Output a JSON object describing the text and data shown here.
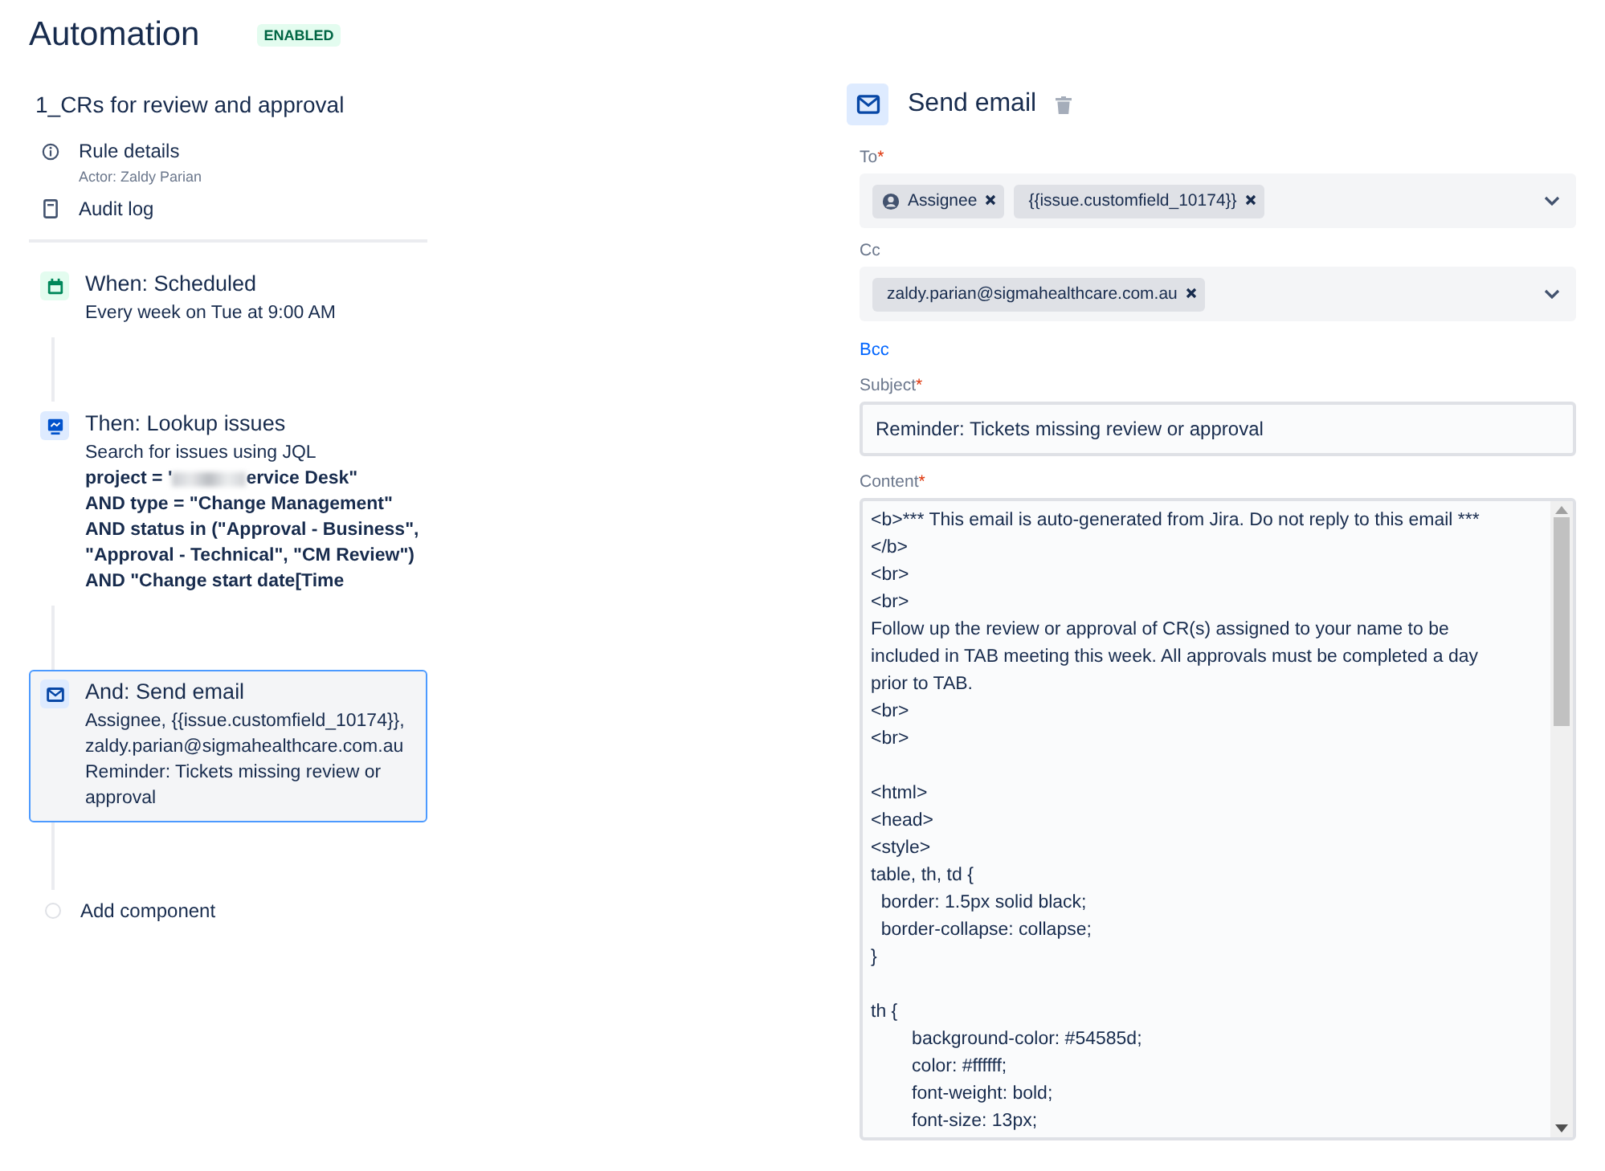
{
  "header": {
    "title": "Automation",
    "status": "ENABLED"
  },
  "rule": {
    "name": "1_CRs for review and approval",
    "links": [
      {
        "kind": "info",
        "label": "Rule details",
        "sub": "Actor: Zaldy Parian"
      },
      {
        "kind": "log",
        "label": "Audit log"
      }
    ]
  },
  "components": [
    {
      "kind": "trigger",
      "title": "When: Scheduled",
      "selected": false,
      "lines": [
        "Every week on Tue at 9:00 AM"
      ]
    },
    {
      "kind": "lookup",
      "title": "Then: Lookup issues",
      "selected": false,
      "lines": [
        "Search for issues using JQL"
      ],
      "redacted_line": {
        "before": "project = '",
        "after": "ervice Desk\""
      },
      "jql": [
        "AND type = \"Change Management\"",
        "AND status in (\"Approval - Business\",",
        "\"Approval - Technical\", \"CM Review\")",
        "AND \"Change start date[Time"
      ]
    },
    {
      "kind": "email",
      "title": "And: Send email",
      "selected": true,
      "lines": [
        "Assignee, {{issue.customfield_10174}},",
        "zaldy.parian@sigmahealthcare.com.au",
        "Reminder: Tickets missing review or",
        "approval"
      ]
    }
  ],
  "add_component": "Add component",
  "editor": {
    "title": "Send email",
    "to": {
      "label": "To",
      "required_mark": "*",
      "chips": [
        {
          "kind": "user",
          "label": "Assignee"
        },
        {
          "kind": "plain",
          "label": "{{issue.customfield_10174}}"
        }
      ]
    },
    "cc": {
      "label": "Cc",
      "chips": [
        {
          "kind": "plain",
          "label": "zaldy.parian@sigmahealthcare.com.au"
        }
      ]
    },
    "bcc": "Bcc",
    "subject": {
      "label": "Subject",
      "required_mark": "*",
      "value": "Reminder: Tickets missing review or approval"
    },
    "content": {
      "label": "Content",
      "required_mark": "*",
      "blocks": [
        [
          "<b>*** This email is auto-generated from Jira. Do not reply to this email ***",
          "</b>",
          "<br>",
          "<br>",
          "Follow up the review or approval of CR(s) assigned to your name to be",
          "included in TAB meeting this week. All approvals must be completed a day",
          "prior to TAB.",
          "<br>",
          "<br>"
        ],
        [
          "<html>",
          "<head>",
          "<style>",
          "table, th, td {",
          "  border: 1.5px solid black;",
          "  border-collapse: collapse;",
          "}"
        ],
        [
          "th {",
          "        background-color: #54585d;",
          "        color: #ffffff;",
          "        font-weight: bold;",
          "        font-size: 13px;"
        ]
      ]
    }
  }
}
